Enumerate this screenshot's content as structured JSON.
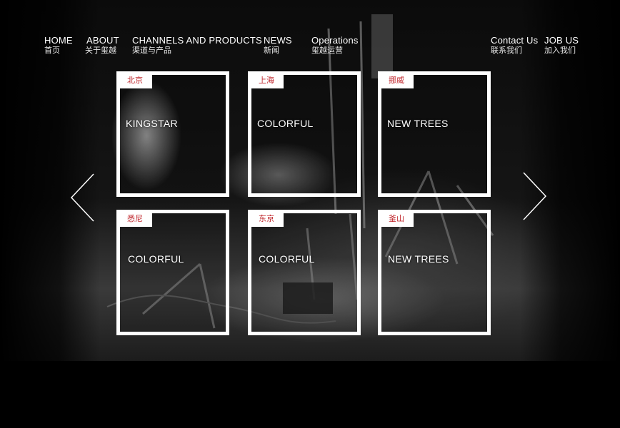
{
  "nav": {
    "left": [
      {
        "en": "HOME",
        "cn": "首页"
      },
      {
        "en": "ABOUT",
        "cn": "关于玺越"
      },
      {
        "en": "CHANNELS AND PRODUCTS",
        "cn": "渠道与产品"
      },
      {
        "en": "NEWS",
        "cn": "新闻"
      },
      {
        "en": "Operations",
        "cn": "玺越运营"
      }
    ],
    "right": [
      {
        "en": "Contact Us",
        "cn": "联系我们"
      },
      {
        "en": "JOB US",
        "cn": "加入我们"
      }
    ]
  },
  "cards": [
    {
      "city": "北京",
      "title": "KINGSTAR"
    },
    {
      "city": "上海",
      "title": "COLORFUL"
    },
    {
      "city": "挪威",
      "title": "NEW TREES"
    },
    {
      "city": "悉尼",
      "title": "COLORFUL"
    },
    {
      "city": "东京",
      "title": "COLORFUL"
    },
    {
      "city": "釜山",
      "title": "NEW TREES"
    }
  ],
  "carousel": {
    "prev_icon": "chevron-left-icon",
    "next_icon": "chevron-right-icon"
  },
  "colors": {
    "background": "#000000",
    "accent": "#c0272d",
    "frame": "#ffffff"
  }
}
